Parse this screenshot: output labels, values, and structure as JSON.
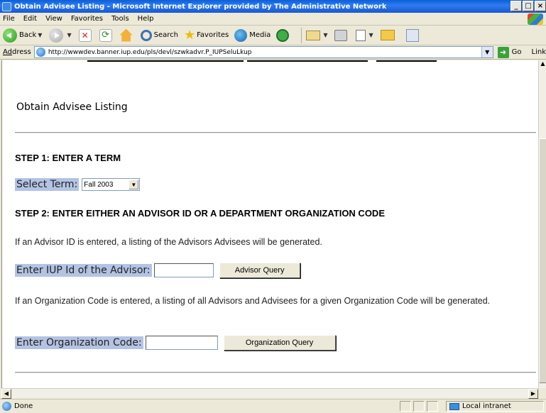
{
  "window": {
    "title": "Obtain Advisee Listing - Microsoft Internet Explorer provided by The Administrative Network"
  },
  "menu": {
    "items": [
      {
        "first": "F",
        "rest": "ile"
      },
      {
        "first": "E",
        "rest": "dit"
      },
      {
        "first": "V",
        "rest": "iew"
      },
      {
        "first": "F",
        "rest": "avorites",
        "pre": ""
      },
      {
        "first": "T",
        "rest": "ools"
      },
      {
        "first": "H",
        "rest": "elp"
      }
    ],
    "labels": [
      "File",
      "Edit",
      "View",
      "Favorites",
      "Tools",
      "Help"
    ]
  },
  "toolbar": {
    "back_label": "Back",
    "search_label": "Search",
    "favorites_label": "Favorites",
    "media_label": "Media"
  },
  "address": {
    "label_prefix": "A",
    "label_ul": "d",
    "label_rest": "dress",
    "url": "http://wwwdev.banner.iup.edu/pls/devl/szwkadvr.P_IUPSeluLkup",
    "go_label": "Go",
    "links_label": "Link"
  },
  "page": {
    "title": "Obtain Advisee Listing",
    "step1_heading": "STEP 1: ENTER A TERM",
    "select_term_label": "Select Term:",
    "term_value": "Fall 2003",
    "step2_heading": "STEP 2: ENTER EITHER AN ADVISOR ID OR A DEPARTMENT ORGANIZATION CODE",
    "advisor_info": "If an Advisor ID is entered, a listing of the Advisors Advisees will be generated.",
    "advisor_label": "Enter IUP Id of the Advisor:",
    "advisor_value": "",
    "advisor_button": "Advisor Query",
    "org_info": "If an Organization Code is entered, a listing of all Advisors and Advisees for a given Organization Code will be generated.",
    "org_label": "Enter Organization Code:",
    "org_value": "",
    "org_button": "Organization Query"
  },
  "status": {
    "text": "Done",
    "zone": "Local intranet"
  }
}
